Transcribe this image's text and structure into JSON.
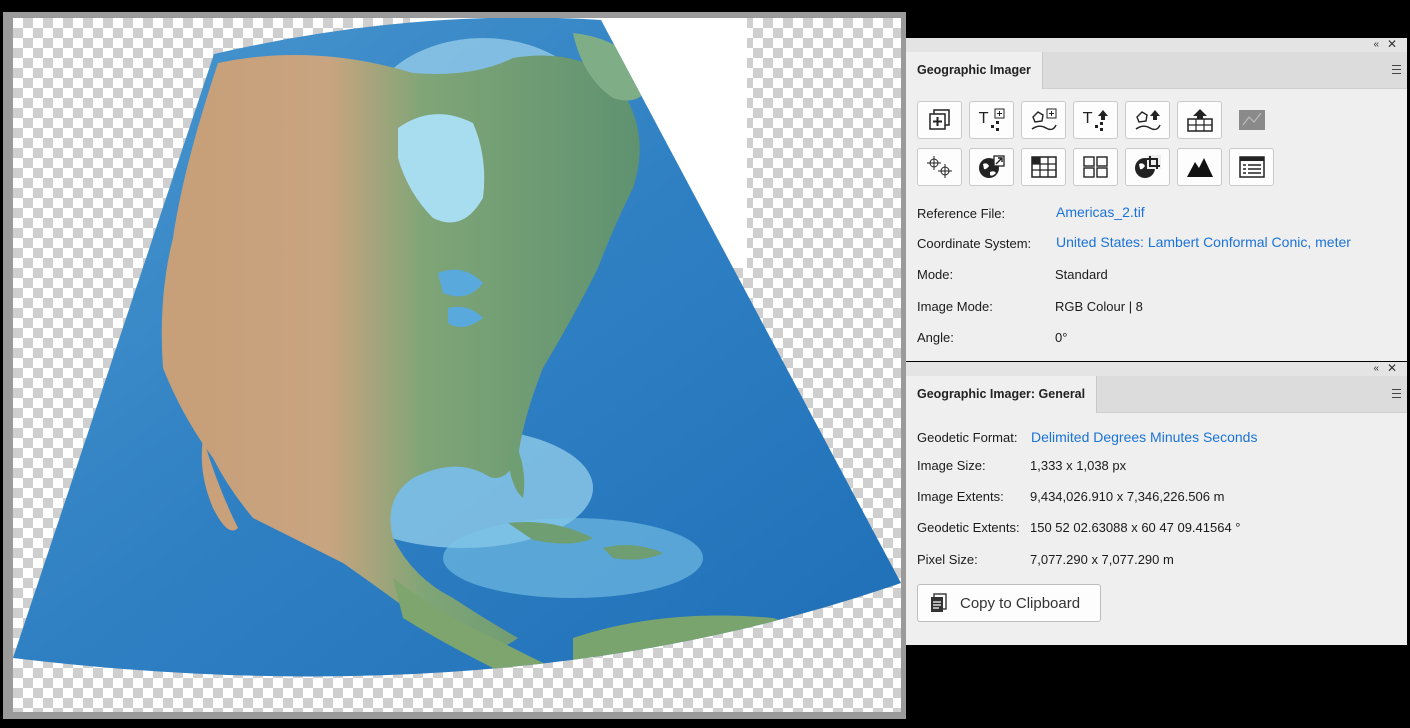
{
  "panel_main": {
    "tab_title": "Geographic Imager",
    "tools_row1": [
      "new-georeference-icon",
      "add-text-points-icon",
      "add-shape-points-icon",
      "import-text-points-icon",
      "import-shape-points-icon",
      "export-icon",
      "disabled-map-icon"
    ],
    "tools_row2": [
      "coordinate-points-icon",
      "transform-globe-icon",
      "tile-grid-icon",
      "mosaic-icon",
      "globe-crop-icon",
      "terrain-icon",
      "table-icon"
    ],
    "fields": [
      {
        "label": "Reference File:",
        "value": "Americas_2.tif",
        "link": true
      },
      {
        "label": "Coordinate System:",
        "value": "United States: Lambert Conformal Conic, meter",
        "link": true
      },
      {
        "label": "Mode:",
        "value": "Standard",
        "link": false
      },
      {
        "label": "Image Mode:",
        "value": "RGB Colour | 8",
        "link": false
      },
      {
        "label": "Angle:",
        "value": "0°",
        "link": false
      }
    ]
  },
  "panel_general": {
    "tab_title": "Geographic Imager: General",
    "fields": [
      {
        "label": "Geodetic Format:",
        "value": "Delimited Degrees Minutes Seconds",
        "link": true
      },
      {
        "label": "Image Size:",
        "value": "1,333 x 1,038 px",
        "link": false
      },
      {
        "label": "Image Extents:",
        "value": "9,434,026.910 x 7,346,226.506 m",
        "link": false
      },
      {
        "label": "Geodetic Extents:",
        "value": "150 52 02.63088 x 60 47 09.41564 °",
        "link": false
      },
      {
        "label": "Pixel Size:",
        "value": "7,077.290 x 7,077.290 m",
        "link": false
      }
    ],
    "copy_button": "Copy to Clipboard"
  },
  "colors": {
    "link": "#1a73d6",
    "ocean_deep": "#1f6fb8",
    "ocean_shallow": "#7cc4e8",
    "land_green": "#6f9e72",
    "land_tan": "#c9a27a"
  }
}
